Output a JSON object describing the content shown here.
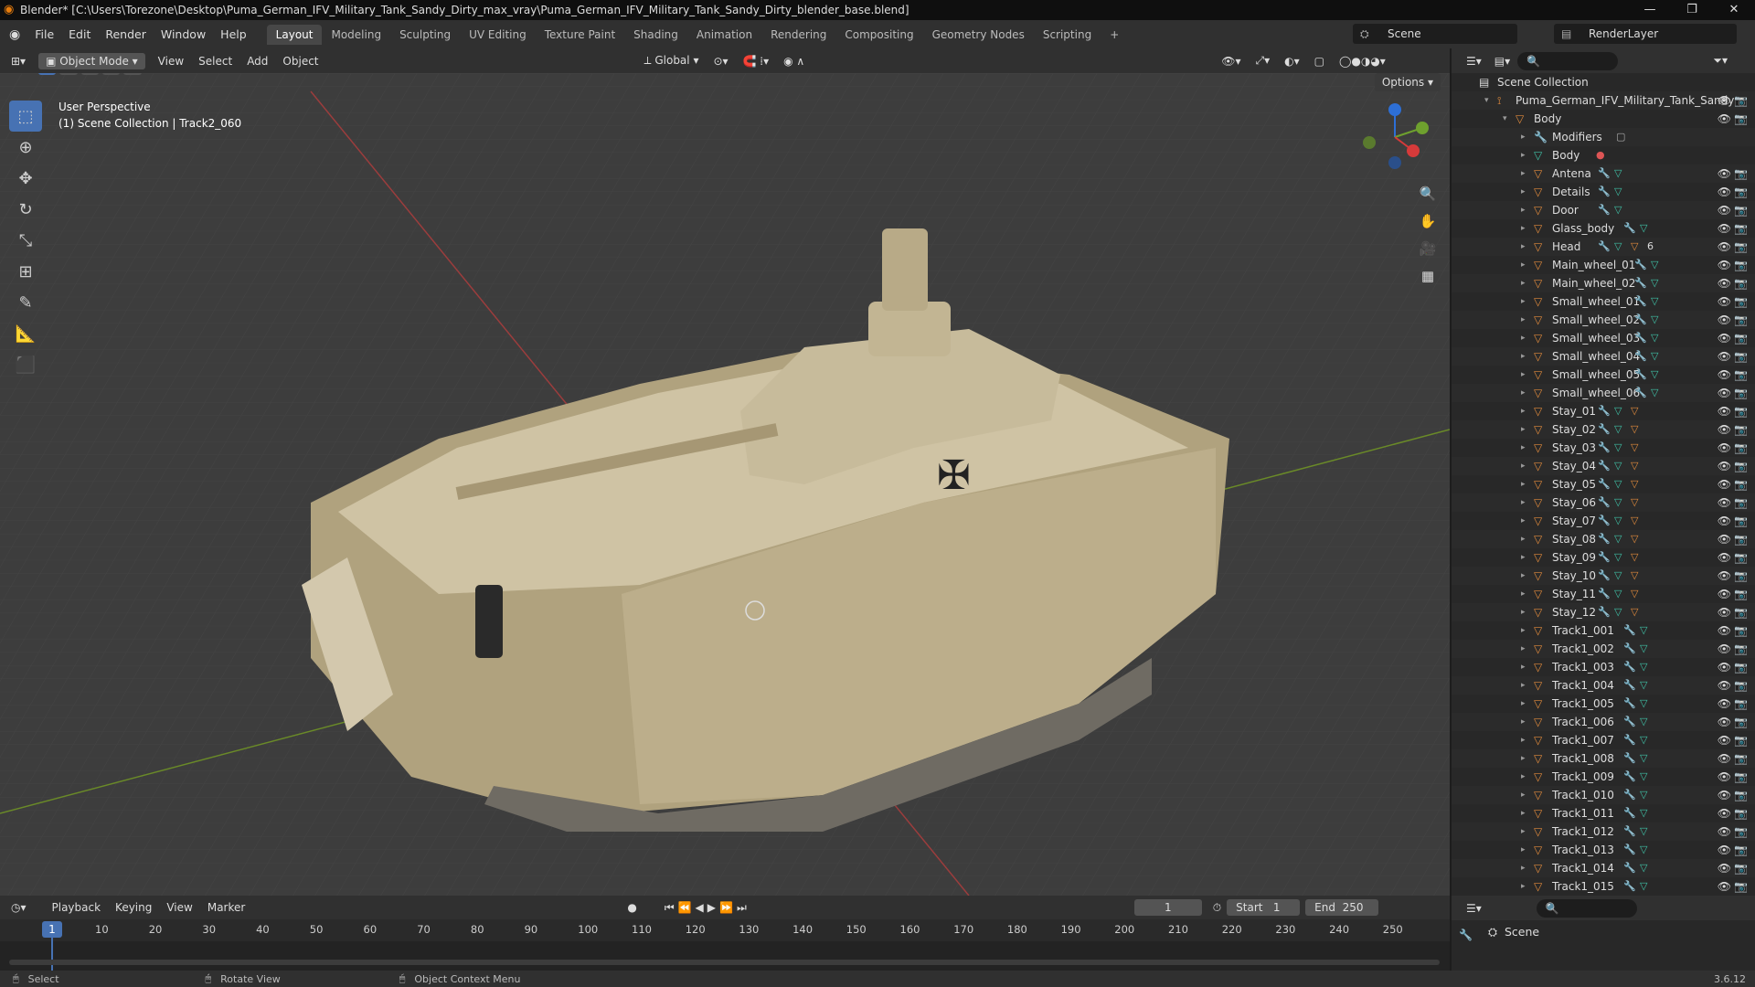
{
  "window": {
    "title": "Blender* [C:\\Users\\Torezone\\Desktop\\Puma_German_IFV_Military_Tank_Sandy_Dirty_max_vray\\Puma_German_IFV_Military_Tank_Sandy_Dirty_blender_base.blend]"
  },
  "menu": {
    "items": [
      "File",
      "Edit",
      "Render",
      "Window",
      "Help"
    ]
  },
  "workspaces": [
    "Layout",
    "Modeling",
    "Sculpting",
    "UV Editing",
    "Texture Paint",
    "Shading",
    "Animation",
    "Rendering",
    "Compositing",
    "Geometry Nodes",
    "Scripting",
    "+"
  ],
  "scene": {
    "name": "Scene",
    "layer": "RenderLayer"
  },
  "viewport_header": {
    "mode": "Object Mode",
    "menus": [
      "View",
      "Select",
      "Add",
      "Object"
    ],
    "transform": "Global",
    "options": "Options"
  },
  "viewport": {
    "perspective": "User Perspective",
    "collection": "(1) Scene Collection | Track2_060"
  },
  "outliner": {
    "root": "Scene Collection",
    "object": "Puma_German_IFV_Military_Tank_Sandy",
    "parent": "Body",
    "modifiers": "Modifiers",
    "mesh": "Body",
    "children": [
      "Antena",
      "Details",
      "Door",
      "Glass_body",
      "Head",
      "Main_wheel_01",
      "Main_wheel_02",
      "Small_wheel_01",
      "Small_wheel_02",
      "Small_wheel_03",
      "Small_wheel_04",
      "Small_wheel_05",
      "Small_wheel_06",
      "Stay_01",
      "Stay_02",
      "Stay_03",
      "Stay_04",
      "Stay_05",
      "Stay_06",
      "Stay_07",
      "Stay_08",
      "Stay_09",
      "Stay_10",
      "Stay_11",
      "Stay_12",
      "Track1_001",
      "Track1_002",
      "Track1_003",
      "Track1_004",
      "Track1_005",
      "Track1_006",
      "Track1_007",
      "Track1_008",
      "Track1_009",
      "Track1_010",
      "Track1_011",
      "Track1_012",
      "Track1_013",
      "Track1_014",
      "Track1_015"
    ],
    "head_badge": "6"
  },
  "timeline": {
    "menus": [
      "Playback",
      "Keying",
      "View",
      "Marker"
    ],
    "current_frame": "1",
    "start_label": "Start",
    "start": "1",
    "end_label": "End",
    "end": "250",
    "ticks": [
      "10",
      "20",
      "30",
      "40",
      "50",
      "60",
      "70",
      "80",
      "90",
      "100",
      "110",
      "120",
      "130",
      "140",
      "150",
      "160",
      "170",
      "180",
      "190",
      "200",
      "210",
      "220",
      "230",
      "240",
      "250"
    ]
  },
  "properties": {
    "scene": "Scene"
  },
  "statusbar": {
    "select": "Select",
    "rotate": "Rotate View",
    "context": "Object Context Menu",
    "version": "3.6.12"
  }
}
